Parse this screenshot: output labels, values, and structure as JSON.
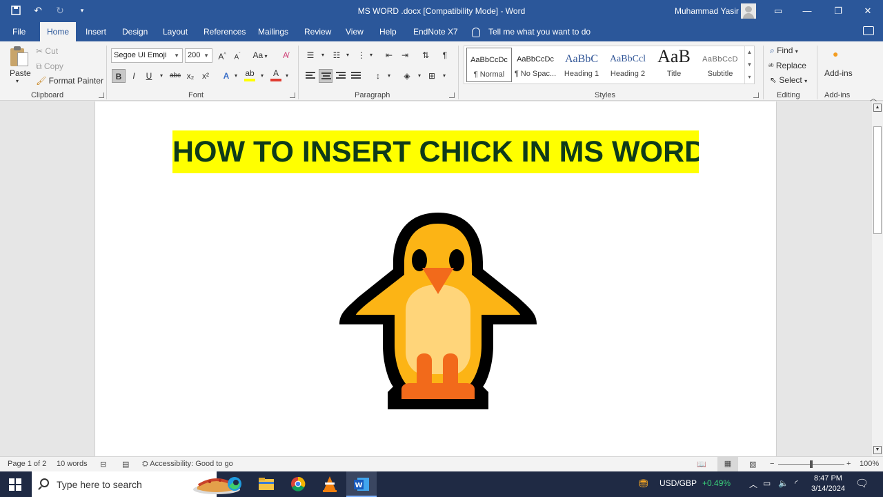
{
  "window": {
    "title": "MS WORD .docx  [Compatibility Mode]  -  Word",
    "user_name": "Muhammad Yasir"
  },
  "tabs": [
    "File",
    "Home",
    "Insert",
    "Design",
    "Layout",
    "References",
    "Mailings",
    "Review",
    "View",
    "Help",
    "EndNote X7"
  ],
  "tell_me": "Tell me what you want to do",
  "clipboard": {
    "paste": "Paste",
    "cut": "Cut",
    "copy": "Copy",
    "format_painter": "Format Painter",
    "label": "Clipboard"
  },
  "font": {
    "name": "Segoe UI Emoji",
    "size": "200",
    "label": "Font",
    "change_case": "Aa",
    "bold": "B",
    "italic": "I",
    "underline": "U",
    "strikethrough": "abc",
    "subscript": "x₂",
    "superscript": "x²",
    "highlight_color": "#ffff00",
    "font_color": "#e03c31"
  },
  "paragraph": {
    "label": "Paragraph",
    "pilcrow": "¶"
  },
  "styles": {
    "label": "Styles",
    "items": [
      {
        "sample": "AaBbCcDc",
        "name": "¶ Normal"
      },
      {
        "sample": "AaBbCcDc",
        "name": "¶ No Spac..."
      },
      {
        "sample": "AaBbC",
        "name": "Heading 1"
      },
      {
        "sample": "AaBbCcl",
        "name": "Heading 2"
      },
      {
        "sample": "AaB",
        "name": "Title"
      },
      {
        "sample": "AaBbCcD",
        "name": "Subtitle"
      }
    ]
  },
  "editing": {
    "find": "Find",
    "replace": "Replace",
    "select": "Select",
    "label": "Editing"
  },
  "addins": {
    "button": "Add-ins",
    "label": "Add-ins"
  },
  "document": {
    "heading": "HOW TO INSERT CHICK IN MS WORD",
    "heading_highlight": "#ffff00",
    "heading_color": "#0e3a1a"
  },
  "status": {
    "page": "Page 1 of 2",
    "words": "10 words",
    "accessibility": "Accessibility: Good to go",
    "zoom": "100%"
  },
  "taskbar": {
    "search_placeholder": "Type here to search",
    "currency_pair": "USD/GBP",
    "currency_change": "+0.49%",
    "time": "8:47 PM",
    "date": "3/14/2024"
  },
  "colors": {
    "word_blue": "#2b579a",
    "ribbon_bg": "#f3f3f3",
    "taskbar_bg": "#1f2a44"
  }
}
